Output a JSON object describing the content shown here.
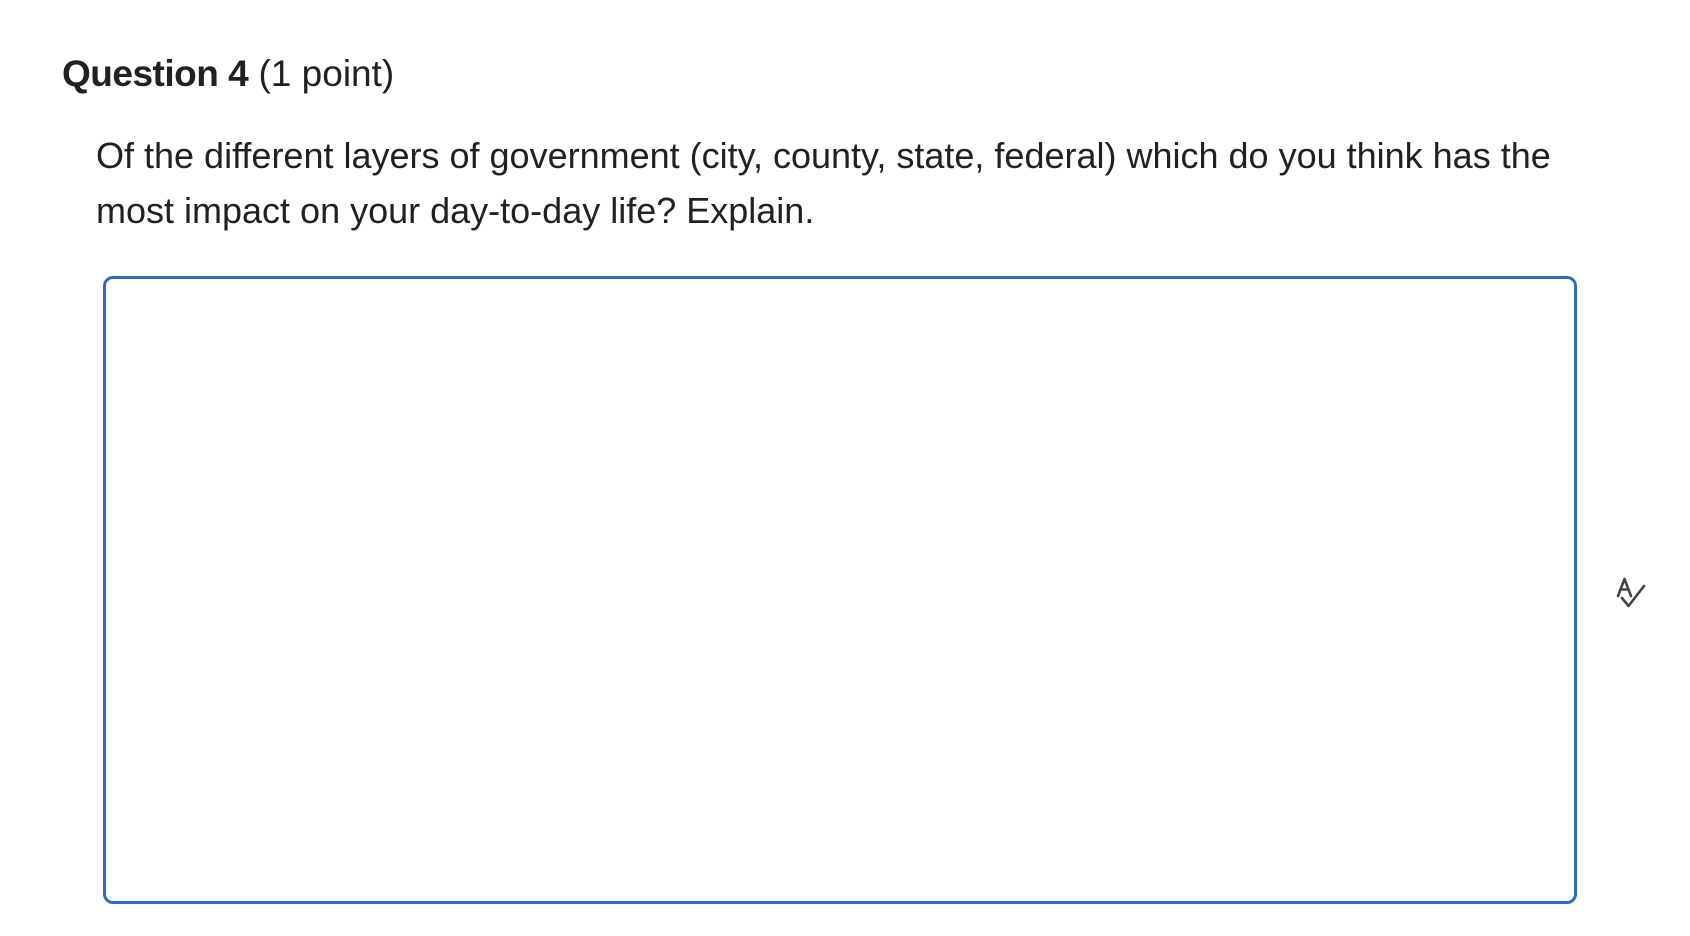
{
  "question": {
    "number_label": "Question 4",
    "points_label": "(1 point)",
    "text": "Of the different layers of government (city, county, state, federal) which do you think has the most impact on your day-to-day life? Explain."
  },
  "answer": {
    "value": "",
    "border_color": "#2f6cc0"
  },
  "icons": {
    "spellcheck": "spellcheck-icon"
  }
}
